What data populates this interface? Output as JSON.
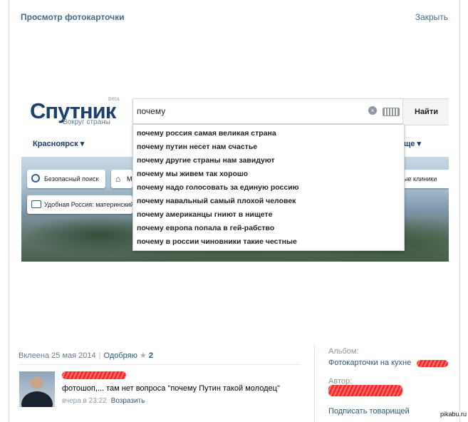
{
  "viewer": {
    "title": "Просмотр фотокарточки",
    "close_label": "Закрыть"
  },
  "screenshot": {
    "logo_text": "Спутник",
    "logo_beta": "beta",
    "logo_tagline": "Вокруг страны",
    "city": "Красноярск",
    "city_more": "ще",
    "search_value": "почему",
    "search_button": "Найти",
    "icons": {
      "clear": "clear-icon",
      "keyboard": "keyboard-icon",
      "search": "magnifier-icon",
      "home": "home-icon",
      "sofa": "sofa-icon"
    },
    "tiles": {
      "safe_search": "Безопасный поиск",
      "home_partial": "М",
      "russia": "Удобная Россия: материнский к",
      "clinics": "ые клиники"
    },
    "suggestions": [
      "почему россия самая великая страна",
      "почему путин несет нам счастье",
      "почему другие страны нам завидуют",
      "почему мы живем так хорошо",
      "почему надо голосовать за единую россию",
      "почему навальный самый плохой человек",
      "почему американцы гниют в нищете",
      "почему европа попала в гей-рабство",
      "почему в россии чиновники такие честные"
    ]
  },
  "photo_meta": {
    "posted": "Вклеена 25 мая 2014",
    "like_label": "Одобряю",
    "like_count": "2",
    "star_icon": "star-icon"
  },
  "comment": {
    "text": "фотошоп,... там нет вопроса \"почему Путин такой молодец\"",
    "time": "вчера в 23:22",
    "reply_label": "Возразить",
    "redaction_color": "#ff1d1d"
  },
  "sidebar": {
    "album_label": "Альбом:",
    "album_link": "Фотокарточки на кухне",
    "author_label": "Автор:",
    "subscribe_link": "Подписать товарищей"
  },
  "watermark": "pikabu.ru"
}
